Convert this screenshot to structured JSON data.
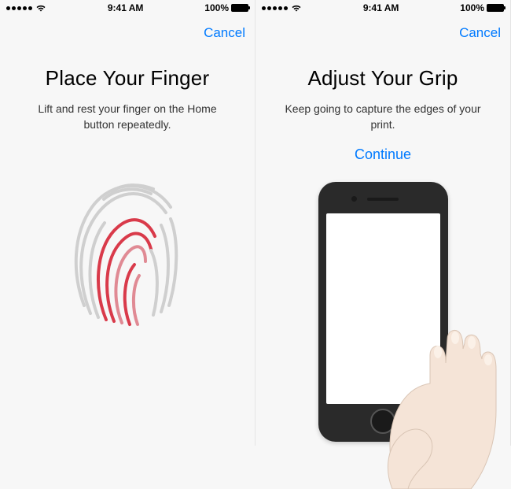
{
  "status_bar": {
    "time": "9:41 AM",
    "battery_text": "100%"
  },
  "left_screen": {
    "cancel_label": "Cancel",
    "title": "Place Your Finger",
    "subtitle": "Lift and rest your finger on the Home button repeatedly."
  },
  "right_screen": {
    "cancel_label": "Cancel",
    "title": "Adjust Your Grip",
    "subtitle": "Keep going to capture the edges of your print.",
    "continue_label": "Continue"
  },
  "colors": {
    "ios_blue": "#007aff",
    "fingerprint_red": "#d93a4a",
    "fingerprint_grey": "#cfcfcf"
  }
}
